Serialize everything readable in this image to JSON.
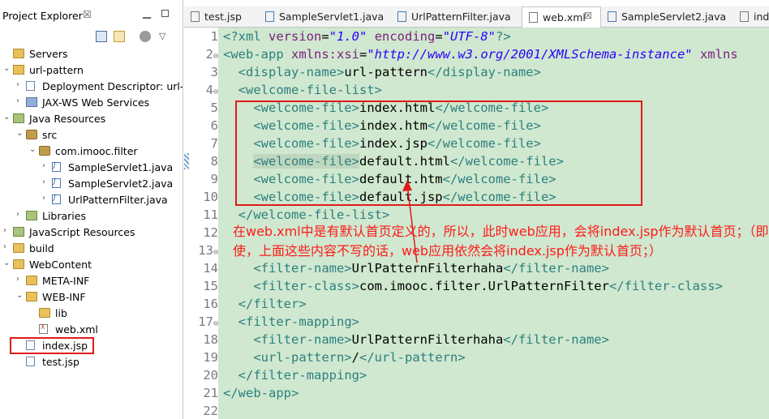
{
  "project_explorer": {
    "title": "Project Explorer",
    "close_glyph": "☒",
    "items": [
      {
        "label": "Servers",
        "icon": "server-folder-icon"
      },
      {
        "label": "url-pattern",
        "icon": "web-project-icon"
      },
      {
        "label": "Deployment Descriptor: url-patt",
        "icon": "deployment-descriptor-icon"
      },
      {
        "label": "JAX-WS Web Services",
        "icon": "web-services-icon"
      },
      {
        "label": "Java Resources",
        "icon": "java-resources-icon"
      },
      {
        "label": "src",
        "icon": "source-folder-icon"
      },
      {
        "label": "com.imooc.filter",
        "icon": "package-icon"
      },
      {
        "label": "SampleServlet1.java",
        "icon": "java-file-icon"
      },
      {
        "label": "SampleServlet2.java",
        "icon": "java-file-icon"
      },
      {
        "label": "UrlPatternFilter.java",
        "icon": "java-file-icon"
      },
      {
        "label": "Libraries",
        "icon": "libraries-icon"
      },
      {
        "label": "JavaScript Resources",
        "icon": "javascript-resources-icon"
      },
      {
        "label": "build",
        "icon": "folder-icon"
      },
      {
        "label": "WebContent",
        "icon": "folder-icon"
      },
      {
        "label": "META-INF",
        "icon": "folder-icon"
      },
      {
        "label": "WEB-INF",
        "icon": "folder-icon"
      },
      {
        "label": "lib",
        "icon": "folder-icon"
      },
      {
        "label": "web.xml",
        "icon": "xml-file-icon"
      },
      {
        "label": "index.jsp",
        "icon": "jsp-file-icon"
      },
      {
        "label": "test.jsp",
        "icon": "jsp-file-icon"
      }
    ]
  },
  "tabs": [
    {
      "label": "test.jsp"
    },
    {
      "label": "SampleServlet1.java"
    },
    {
      "label": "UrlPatternFilter.java"
    },
    {
      "label": "web.xml",
      "active": true
    },
    {
      "label": "SampleServlet2.java"
    },
    {
      "label": "ind"
    }
  ],
  "tab_close_glyph": "☒",
  "editor": {
    "line_numbers": [
      "1",
      "2",
      "3",
      "4",
      "5",
      "6",
      "7",
      "8",
      "9",
      "10",
      "11",
      "12",
      "13",
      "14",
      "15",
      "16",
      "17",
      "18",
      "19",
      "20",
      "21",
      "22"
    ],
    "fold_markers": {
      "2": "⊖",
      "4": "⊖",
      "13": "⊖",
      "17": "⊖"
    },
    "lines": [
      [
        [
          "tag",
          "<?xml "
        ],
        [
          "attr",
          "version"
        ],
        [
          "txt",
          "="
        ],
        [
          "str",
          "\"1.0\""
        ],
        [
          "txt",
          " "
        ],
        [
          "attr",
          "encoding"
        ],
        [
          "txt",
          "="
        ],
        [
          "str",
          "\"UTF-8\""
        ],
        [
          "tag",
          "?>"
        ]
      ],
      [
        [
          "tag",
          "<web-app "
        ],
        [
          "attr",
          "xmlns:xsi"
        ],
        [
          "txt",
          "="
        ],
        [
          "str",
          "\"http://www.w3.org/2001/XMLSchema-instance\""
        ],
        [
          "txt",
          " "
        ],
        [
          "attr",
          "xmlns"
        ]
      ],
      [
        [
          "txt",
          "  "
        ],
        [
          "tag",
          "<display-name>"
        ],
        [
          "txt",
          "url-pattern"
        ],
        [
          "tag",
          "</display-name>"
        ]
      ],
      [
        [
          "txt",
          "  "
        ],
        [
          "tag",
          "<welcome-file-list>"
        ]
      ],
      [
        [
          "txt",
          "    "
        ],
        [
          "tag",
          "<welcome-file>"
        ],
        [
          "txt",
          "index.html"
        ],
        [
          "tag",
          "</welcome-file>"
        ]
      ],
      [
        [
          "txt",
          "    "
        ],
        [
          "tag",
          "<welcome-file>"
        ],
        [
          "txt",
          "index.htm"
        ],
        [
          "tag",
          "</welcome-file>"
        ]
      ],
      [
        [
          "txt",
          "    "
        ],
        [
          "tag",
          "<welcome-file>"
        ],
        [
          "txt",
          "index.jsp"
        ],
        [
          "tag",
          "</welcome-file>"
        ]
      ],
      [
        [
          "txt",
          "    "
        ],
        [
          "tag",
          "<welcome-file>"
        ],
        [
          "txt",
          "default.html"
        ],
        [
          "tag",
          "</welcome-file>"
        ]
      ],
      [
        [
          "txt",
          "    "
        ],
        [
          "tag",
          "<welcome-file>"
        ],
        [
          "txt",
          "default.htm"
        ],
        [
          "tag",
          "</welcome-file>"
        ]
      ],
      [
        [
          "txt",
          "    "
        ],
        [
          "tag",
          "<welcome-file>"
        ],
        [
          "txt",
          "default.jsp"
        ],
        [
          "tag",
          "</welcome-file>"
        ]
      ],
      [
        [
          "txt",
          "  "
        ],
        [
          "tag",
          "</welcome-file-list>"
        ]
      ],
      [],
      [],
      [
        [
          "txt",
          "    "
        ],
        [
          "tag",
          "<filter-name>"
        ],
        [
          "txt",
          "UrlPatternFilterhaha"
        ],
        [
          "tag",
          "</filter-name>"
        ]
      ],
      [
        [
          "txt",
          "    "
        ],
        [
          "tag",
          "<filter-class>"
        ],
        [
          "txt",
          "com.imooc.filter.UrlPatternFilter"
        ],
        [
          "tag",
          "</filter-class>"
        ]
      ],
      [
        [
          "txt",
          "  "
        ],
        [
          "tag",
          "</filter>"
        ]
      ],
      [
        [
          "txt",
          "  "
        ],
        [
          "tag",
          "<filter-mapping>"
        ]
      ],
      [
        [
          "txt",
          "    "
        ],
        [
          "tag",
          "<filter-name>"
        ],
        [
          "txt",
          "UrlPatternFilterhaha"
        ],
        [
          "tag",
          "</filter-name>"
        ]
      ],
      [
        [
          "txt",
          "    "
        ],
        [
          "tag",
          "<url-pattern>"
        ],
        [
          "txt",
          "/"
        ],
        [
          "tag",
          "</url-pattern>"
        ]
      ],
      [
        [
          "txt",
          "  "
        ],
        [
          "tag",
          "</filter-mapping>"
        ]
      ],
      [
        [
          "tag",
          "</web-app>"
        ]
      ],
      []
    ],
    "highlight_line": 8
  },
  "annotation": {
    "text": "在web.xml中是有默认首页定义的，所以，此时web应用，会将index.jsp作为默认首页；（即使，上面这些内容不写的话，web应用依然会将index.jsp作为默认首页；）"
  },
  "colors": {
    "tag": "#2d7f7f",
    "attribute": "#7d1e7d",
    "string": "#2a00ff",
    "editor_background": "#cfe8cf",
    "annotation": "#ff1a1a",
    "highlight_box": "#e01b1b"
  }
}
